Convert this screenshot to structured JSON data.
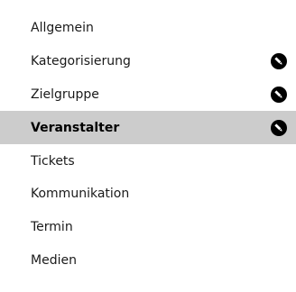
{
  "nav": {
    "items": [
      {
        "label": "Allgemein",
        "has_edit": false,
        "active": false
      },
      {
        "label": "Kategorisierung",
        "has_edit": true,
        "active": false
      },
      {
        "label": "Zielgruppe",
        "has_edit": true,
        "active": false
      },
      {
        "label": "Veranstalter",
        "has_edit": true,
        "active": true
      },
      {
        "label": "Tickets",
        "has_edit": false,
        "active": false
      },
      {
        "label": "Kommunikation",
        "has_edit": false,
        "active": false
      },
      {
        "label": "Termin",
        "has_edit": false,
        "active": false
      },
      {
        "label": "Medien",
        "has_edit": false,
        "active": false
      }
    ]
  },
  "icons": {
    "edit": "pencil-circle-icon"
  },
  "colors": {
    "active_background": "#cccccc",
    "text": "#1a1a1a",
    "icon": "#000000"
  }
}
